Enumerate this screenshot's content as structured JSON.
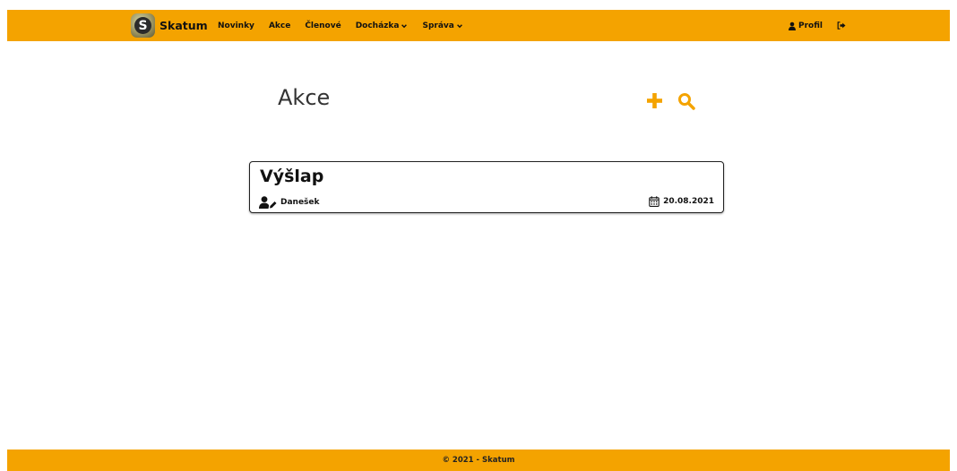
{
  "app": {
    "brand": "Skatum",
    "logo_letter": "S"
  },
  "nav": {
    "items": [
      {
        "label": "Novinky"
      },
      {
        "label": "Akce"
      },
      {
        "label": "Členové"
      },
      {
        "label": "Docházka",
        "dropdown": true
      },
      {
        "label": "Správa",
        "dropdown": true
      }
    ],
    "profile_label": "Profil",
    "logout_icon": "sign-out-icon"
  },
  "page": {
    "title": "Akce"
  },
  "actions": {
    "add_icon": "plus-icon",
    "search_icon": "search-icon"
  },
  "events": [
    {
      "title": "Výšlap",
      "author": "Danešek",
      "date": "20.08.2021"
    }
  ],
  "footer": {
    "text": "© 2021 - Skatum"
  },
  "colors": {
    "accent": "#f4a300",
    "text": "#111111"
  }
}
